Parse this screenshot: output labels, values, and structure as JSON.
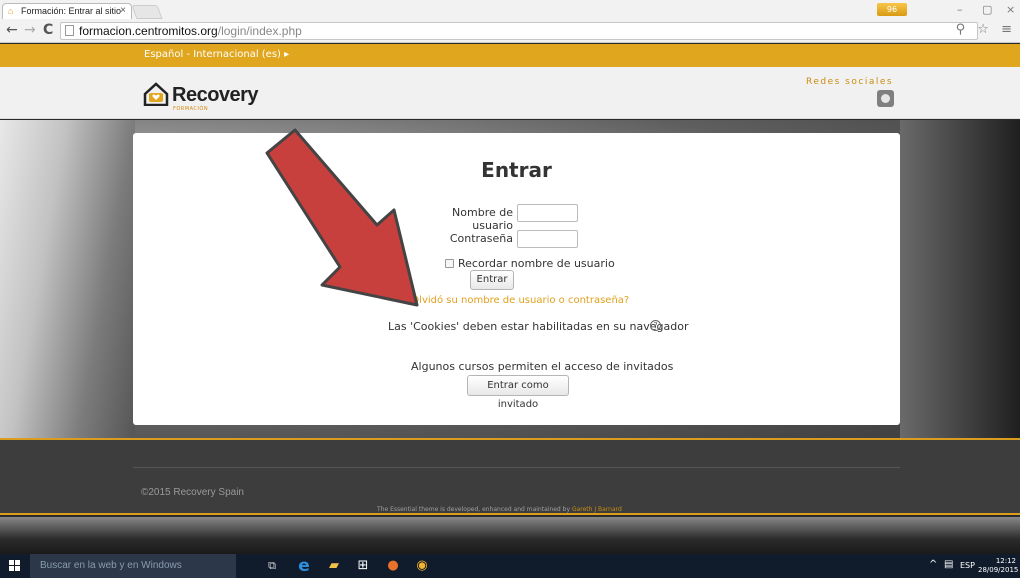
{
  "browser": {
    "tab_title": "Formación: Entrar al sitio",
    "tab_close": "×",
    "url_host": "formacion.centromitos.org",
    "url_path": "/login/index.php",
    "notification_badge": "96",
    "nav": {
      "back": "←",
      "forward": "→",
      "reload": "C"
    },
    "window_controls": {
      "minimize": "–",
      "maximize": "▢",
      "close": "×"
    },
    "addr_icons": "⚲ ☆ ≡"
  },
  "site": {
    "language_selector": "Español - Internacional (es) ▸",
    "logo_text": "Recovery",
    "logo_subtext": "FORMACIÓN",
    "social_title": "Redes sociales",
    "accent_color": "#e0a61e"
  },
  "login": {
    "title": "Entrar",
    "username_label": "Nombre de usuario",
    "password_label": "Contraseña",
    "remember_label": "Recordar nombre de usuario",
    "submit_label": "Entrar",
    "forgot_link": "¿Olvidó su nombre de usuario o contraseña?",
    "cookies_notice": "Las 'Cookies' deben estar habilitadas en su navegador",
    "guest_notice": "Algunos cursos permiten el acceso de invitados",
    "guest_button": "Entrar como invitado",
    "help_icon": "?"
  },
  "footer": {
    "copyright": "©2015 Recovery Spain",
    "credit_text": "The Essential theme is developed, enhanced and maintained by",
    "credit_link": "Gareth J Barnard"
  },
  "taskbar": {
    "search_placeholder": "Buscar en la web y en Windows",
    "language": "ESP",
    "time": "12:12",
    "date": "28/09/2015"
  }
}
